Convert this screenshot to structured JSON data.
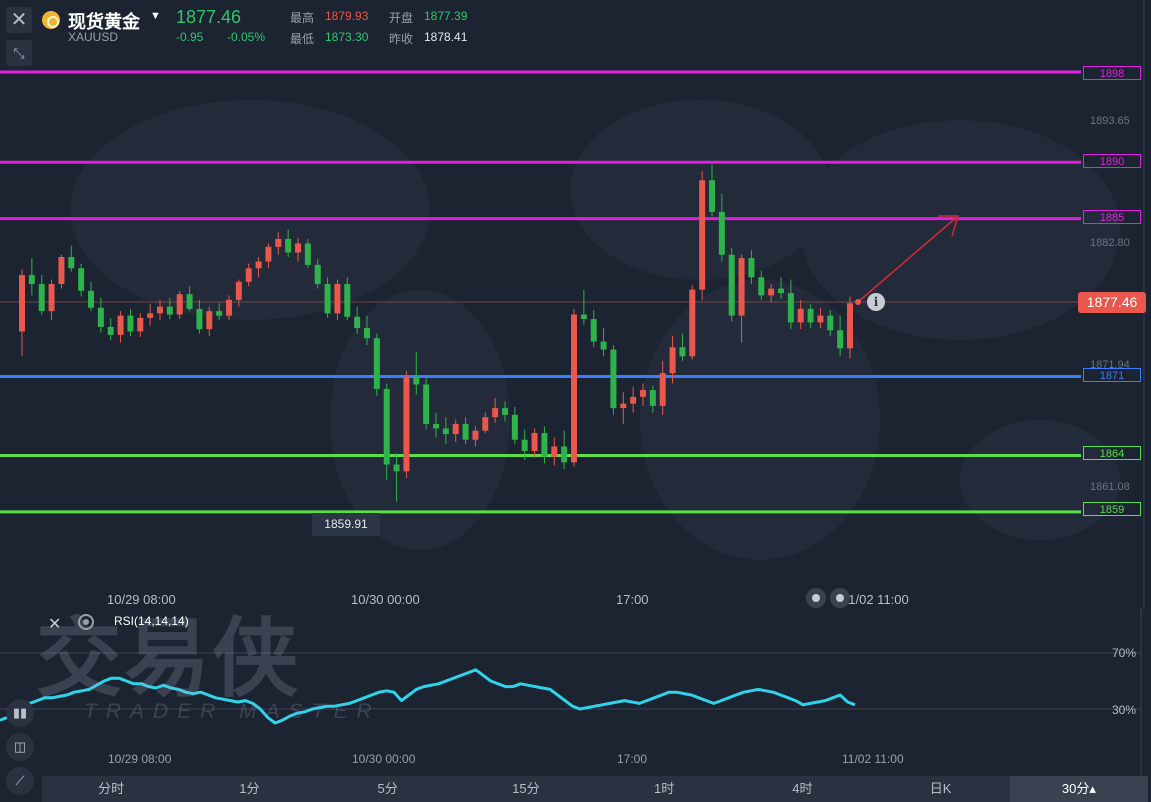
{
  "header": {
    "symbol_name": "现货黄金",
    "symbol_code": "XAUUSD",
    "price": "1877.46",
    "change": "-0.95",
    "change_pct": "-0.05%",
    "high_label": "最高",
    "high": "1879.93",
    "open_label": "开盘",
    "open": "1877.39",
    "low_label": "最低",
    "low": "1873.30",
    "prev_close_label": "昨收",
    "prev_close": "1878.41"
  },
  "levels": [
    {
      "value": "1898",
      "color": "#e020e0"
    },
    {
      "value": "1890",
      "color": "#e020e0"
    },
    {
      "value": "1885",
      "color": "#e020e0"
    },
    {
      "value": "1871",
      "color": "#3b7bff"
    },
    {
      "value": "1864",
      "color": "#5bde4a"
    },
    {
      "value": "1859",
      "color": "#5bde4a"
    }
  ],
  "price_axis": {
    "ticks": [
      "1893.65",
      "1882.80",
      "1871.94",
      "1861.08"
    ],
    "current_price": "1877.46",
    "period_low": "1859.91"
  },
  "time_axis": [
    "10/29 08:00",
    "10/30 00:00",
    "17:00",
    "11/02 11:00"
  ],
  "rsi": {
    "title": "RSI(14,14,14)",
    "level_high": "70%",
    "level_low": "30%",
    "color": "#2fd3ea",
    "time_axis": [
      "10/29 08:00",
      "10/30 00:00",
      "17:00",
      "11/02 11:00"
    ]
  },
  "watermark": {
    "main": "交易侠",
    "sub": "TRADER MASTER"
  },
  "periods": [
    {
      "label": "分时",
      "active": false
    },
    {
      "label": "1分",
      "active": false
    },
    {
      "label": "5分",
      "active": false
    },
    {
      "label": "15分",
      "active": false
    },
    {
      "label": "1时",
      "active": false
    },
    {
      "label": "4时",
      "active": false
    },
    {
      "label": "日K",
      "active": false
    },
    {
      "label": "30分▴",
      "active": true
    }
  ],
  "colors": {
    "up": "#e9574d",
    "down": "#2db34a",
    "background": "#1c2331",
    "arrow": "#d42a38"
  },
  "chart_data": {
    "type": "candlestick",
    "symbol": "XAUUSD",
    "interval": "30分",
    "ylim": [
      1857,
      1901
    ],
    "candles": [
      [
        1875.0,
        1880.5,
        1872.8,
        1880.0
      ],
      [
        1880.0,
        1881.5,
        1878.2,
        1879.2
      ],
      [
        1879.2,
        1880.0,
        1876.5,
        1876.8
      ],
      [
        1876.8,
        1879.6,
        1876.0,
        1879.2
      ],
      [
        1879.2,
        1881.8,
        1878.8,
        1881.6
      ],
      [
        1881.6,
        1882.6,
        1880.3,
        1880.6
      ],
      [
        1880.6,
        1881.0,
        1878.1,
        1878.6
      ],
      [
        1878.6,
        1879.4,
        1876.8,
        1877.1
      ],
      [
        1877.1,
        1878.0,
        1874.9,
        1875.4
      ],
      [
        1875.4,
        1876.2,
        1874.2,
        1874.7
      ],
      [
        1874.7,
        1876.8,
        1874.0,
        1876.4
      ],
      [
        1876.4,
        1877.0,
        1874.6,
        1875.0
      ],
      [
        1875.0,
        1876.6,
        1874.5,
        1876.2
      ],
      [
        1876.2,
        1877.4,
        1875.5,
        1876.6
      ],
      [
        1876.6,
        1877.8,
        1876.0,
        1877.2
      ],
      [
        1877.2,
        1878.0,
        1876.1,
        1876.5
      ],
      [
        1876.5,
        1878.6,
        1876.1,
        1878.3
      ],
      [
        1878.3,
        1879.0,
        1876.8,
        1877.0
      ],
      [
        1877.0,
        1877.8,
        1874.8,
        1875.2
      ],
      [
        1875.2,
        1877.2,
        1874.6,
        1876.8
      ],
      [
        1876.8,
        1877.5,
        1876.0,
        1876.4
      ],
      [
        1876.4,
        1878.2,
        1876.0,
        1877.8
      ],
      [
        1877.8,
        1879.6,
        1877.2,
        1879.4
      ],
      [
        1879.4,
        1881.0,
        1879.0,
        1880.6
      ],
      [
        1880.6,
        1881.6,
        1879.8,
        1881.2
      ],
      [
        1881.2,
        1882.8,
        1880.6,
        1882.5
      ],
      [
        1882.5,
        1883.8,
        1881.8,
        1883.2
      ],
      [
        1883.2,
        1884.0,
        1881.6,
        1882.0
      ],
      [
        1882.0,
        1883.3,
        1881.2,
        1882.8
      ],
      [
        1882.8,
        1883.2,
        1880.6,
        1880.9
      ],
      [
        1880.9,
        1881.4,
        1878.8,
        1879.2
      ],
      [
        1879.2,
        1879.8,
        1876.2,
        1876.6
      ],
      [
        1876.6,
        1879.6,
        1876.0,
        1879.2
      ],
      [
        1879.2,
        1879.8,
        1876.0,
        1876.3
      ],
      [
        1876.3,
        1877.2,
        1874.8,
        1875.3
      ],
      [
        1875.3,
        1876.4,
        1873.8,
        1874.4
      ],
      [
        1874.4,
        1874.8,
        1869.3,
        1869.9
      ],
      [
        1869.9,
        1870.4,
        1861.8,
        1863.2
      ],
      [
        1863.2,
        1864.2,
        1859.9,
        1862.6
      ],
      [
        1862.6,
        1871.5,
        1862.0,
        1871.0
      ],
      [
        1871.0,
        1873.2,
        1869.4,
        1870.3
      ],
      [
        1870.3,
        1871.0,
        1866.3,
        1866.8
      ],
      [
        1866.8,
        1867.8,
        1865.6,
        1866.4
      ],
      [
        1866.4,
        1867.4,
        1865.0,
        1865.9
      ],
      [
        1865.9,
        1867.2,
        1865.2,
        1866.8
      ],
      [
        1866.8,
        1867.4,
        1865.0,
        1865.4
      ],
      [
        1865.4,
        1866.6,
        1864.8,
        1866.2
      ],
      [
        1866.2,
        1867.8,
        1866.0,
        1867.4
      ],
      [
        1867.4,
        1869.1,
        1866.9,
        1868.2
      ],
      [
        1868.2,
        1868.8,
        1867.0,
        1867.6
      ],
      [
        1867.6,
        1868.3,
        1865.0,
        1865.4
      ],
      [
        1865.4,
        1866.3,
        1863.6,
        1864.4
      ],
      [
        1864.4,
        1866.4,
        1863.8,
        1866.0
      ],
      [
        1866.0,
        1866.6,
        1863.3,
        1863.9
      ],
      [
        1863.9,
        1865.6,
        1863.1,
        1864.8
      ],
      [
        1864.8,
        1866.2,
        1862.8,
        1863.4
      ],
      [
        1863.4,
        1877.0,
        1863.0,
        1876.5
      ],
      [
        1876.5,
        1878.7,
        1875.6,
        1876.1
      ],
      [
        1876.1,
        1876.9,
        1873.6,
        1874.1
      ],
      [
        1874.1,
        1875.3,
        1872.8,
        1873.4
      ],
      [
        1873.4,
        1873.8,
        1867.6,
        1868.2
      ],
      [
        1868.2,
        1869.6,
        1866.8,
        1868.6
      ],
      [
        1868.6,
        1870.1,
        1867.8,
        1869.2
      ],
      [
        1869.2,
        1870.4,
        1868.4,
        1869.8
      ],
      [
        1869.8,
        1870.2,
        1867.8,
        1868.4
      ],
      [
        1868.4,
        1872.4,
        1867.6,
        1871.3
      ],
      [
        1871.3,
        1874.6,
        1870.4,
        1873.6
      ],
      [
        1873.6,
        1874.8,
        1872.4,
        1872.8
      ],
      [
        1872.8,
        1879.1,
        1872.5,
        1878.7
      ],
      [
        1878.7,
        1889.2,
        1877.8,
        1888.4
      ],
      [
        1888.4,
        1889.8,
        1885.2,
        1885.6
      ],
      [
        1885.6,
        1887.2,
        1881.2,
        1881.8
      ],
      [
        1881.8,
        1882.4,
        1875.9,
        1876.4
      ],
      [
        1876.4,
        1881.8,
        1874.0,
        1881.5
      ],
      [
        1881.5,
        1882.2,
        1879.2,
        1879.8
      ],
      [
        1879.8,
        1880.4,
        1877.8,
        1878.2
      ],
      [
        1878.2,
        1879.2,
        1877.6,
        1878.8
      ],
      [
        1878.8,
        1879.8,
        1877.9,
        1878.4
      ],
      [
        1878.4,
        1879.6,
        1875.2,
        1875.8
      ],
      [
        1875.8,
        1877.8,
        1875.2,
        1877.0
      ],
      [
        1877.0,
        1877.4,
        1875.3,
        1875.8
      ],
      [
        1875.8,
        1877.1,
        1875.3,
        1876.4
      ],
      [
        1876.4,
        1876.9,
        1874.6,
        1875.1
      ],
      [
        1875.1,
        1876.4,
        1872.8,
        1873.5
      ],
      [
        1873.5,
        1878.1,
        1872.6,
        1877.5
      ]
    ],
    "rsi": [
      22,
      24,
      25,
      30,
      34,
      36,
      38,
      38,
      39,
      40,
      42,
      43,
      44,
      47,
      50,
      52,
      52,
      50,
      48,
      48,
      46,
      45,
      47,
      45,
      44,
      42,
      41,
      42,
      40,
      38,
      37,
      36,
      35,
      36,
      34,
      30,
      24,
      20,
      22,
      25,
      27,
      28,
      30,
      31,
      32,
      32,
      33,
      34,
      36,
      38,
      40,
      42,
      43,
      42,
      36,
      40,
      44,
      46,
      47,
      48,
      50,
      52,
      54,
      56,
      58,
      54,
      50,
      48,
      46,
      46,
      48,
      47,
      46,
      45,
      44,
      40,
      36,
      32,
      30,
      31,
      32,
      33,
      34,
      35,
      36,
      35,
      34,
      36,
      38,
      40,
      42,
      42,
      41,
      40,
      38,
      36,
      34,
      36,
      38,
      40,
      42,
      43,
      44,
      43,
      42,
      40,
      38,
      36,
      33,
      34,
      35,
      36,
      38,
      40,
      35,
      33
    ],
    "rsi_ylim": [
      0,
      100
    ]
  }
}
